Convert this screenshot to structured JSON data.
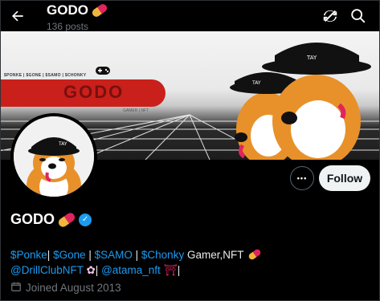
{
  "header": {
    "back_icon": "arrow-left-icon",
    "title": "GODO",
    "title_emoji": "pill-icon",
    "post_count": "136 posts",
    "actions": [
      "refresh-icon",
      "search-icon"
    ]
  },
  "banner": {
    "tickers": "$PONKE | $GONE | $SAMO | $CHONKY",
    "logo_text": "GODO",
    "subtitle": "GAMER | NFT"
  },
  "buttons": {
    "more": "•••",
    "follow": "Follow"
  },
  "profile": {
    "display_name": "GODO",
    "verified": true,
    "bio": {
      "line1": [
        {
          "text": "$Ponke",
          "type": "link"
        },
        {
          "text": "| ",
          "type": "text"
        },
        {
          "text": "$Gone",
          "type": "link"
        },
        {
          "text": " | ",
          "type": "text"
        },
        {
          "text": "$SAMO",
          "type": "link"
        },
        {
          "text": " | ",
          "type": "text"
        },
        {
          "text": "$Chonky",
          "type": "link"
        },
        {
          "text": " Gamer,NFT",
          "type": "text"
        }
      ],
      "line2": [
        {
          "text": "@DrillClubNFT",
          "type": "link"
        },
        {
          "text": "| ",
          "type": "text"
        },
        {
          "text": "@atama_nft",
          "type": "link"
        },
        {
          "text": "|",
          "type": "text"
        }
      ]
    },
    "joined": "Joined August 2013"
  },
  "colors": {
    "accent": "#1d9bf0",
    "banner_red": "#c9201c",
    "dog_orange": "#e8912a"
  }
}
